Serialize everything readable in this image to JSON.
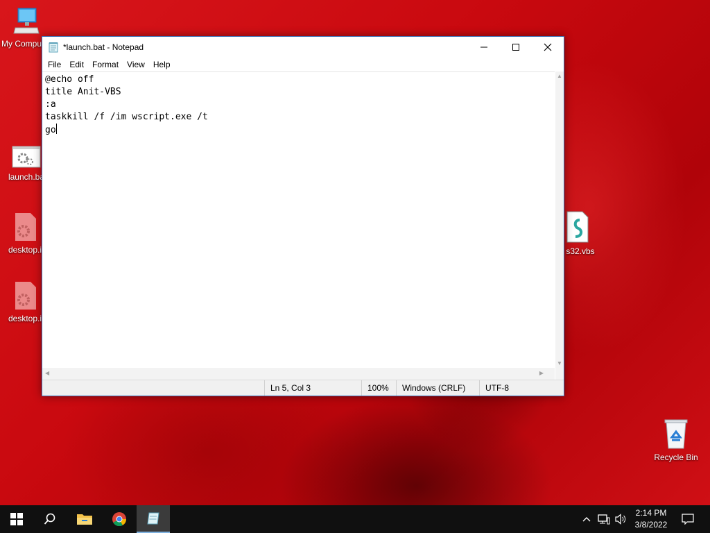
{
  "desktop": {
    "icons": [
      {
        "label": "My Comput"
      },
      {
        "label": "launch.ba"
      },
      {
        "label": "desktop.i"
      },
      {
        "label": "desktop.i"
      },
      {
        "label": "s32.vbs"
      },
      {
        "label": "Recycle Bin"
      }
    ]
  },
  "notepad": {
    "title": "*launch.bat - Notepad",
    "menu": [
      "File",
      "Edit",
      "Format",
      "View",
      "Help"
    ],
    "content_lines": [
      "@echo off",
      "title Anit-VBS",
      ":a",
      "taskkill /f /im wscript.exe /t",
      "go"
    ],
    "status": {
      "position": "Ln 5, Col 3",
      "zoom": "100%",
      "line_ending": "Windows (CRLF)",
      "encoding": "UTF-8"
    }
  },
  "taskbar": {
    "pinned": [
      "start-icon",
      "search-icon",
      "file-explorer-icon",
      "chrome-icon",
      "notepad-icon"
    ],
    "clock": {
      "time": "2:14 PM",
      "date": "3/8/2022"
    }
  },
  "colors": {
    "desktop_red": "#c9090f",
    "taskbar": "#101010",
    "window_border": "#3a6fb5"
  }
}
